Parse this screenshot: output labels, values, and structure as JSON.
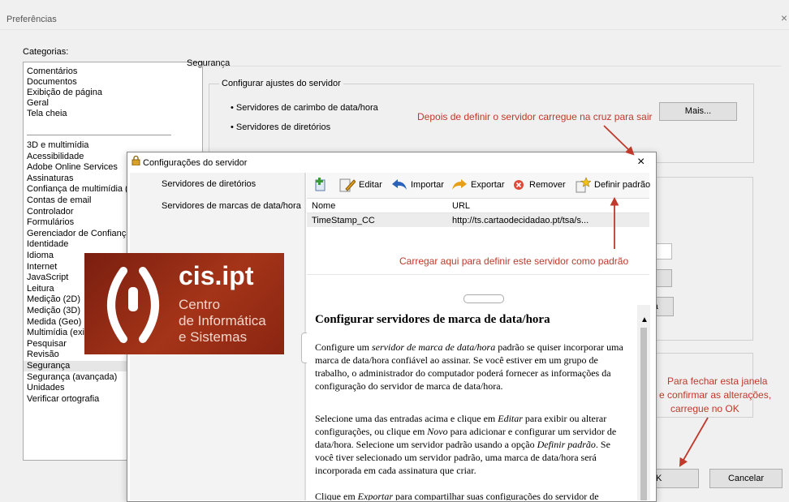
{
  "window": {
    "title": "Preferências",
    "close": "×"
  },
  "categories": {
    "label": "Categorias:",
    "top_items": [
      "Comentários",
      "Documentos",
      "Exibição de página",
      "Geral",
      "Tela cheia"
    ],
    "items": [
      "3D e multimídia",
      "Acessibilidade",
      "Adobe Online Services",
      "Assinaturas",
      "Confiança de multimídia (e",
      "Contas de email",
      "Controlador",
      "Formulários",
      "Gerenciador de Confiança",
      "Identidade",
      "Idioma",
      "Internet",
      "JavaScript",
      "Leitura",
      "Medição (2D)",
      "Medição (3D)",
      "Medida (Geo)",
      "Multimídia (existente)",
      "Pesquisar",
      "Revisão",
      "Segurança",
      "Segurança (avançada)",
      "Unidades",
      "Verificar ortografia"
    ],
    "selected": "Segurança"
  },
  "security": {
    "group": "Segurança",
    "server_group": "Configurar ajustes do servidor",
    "bullet1": "• Servidores de carimbo de data/hora",
    "bullet2": "• Servidores de diretórios",
    "more_button": "Mais...",
    "partial_button": "ra"
  },
  "footer": {
    "ok": "OK",
    "ok_visible": "K",
    "cancel": "Cancelar"
  },
  "annotations": {
    "exit": "Depois de definir o servidor carregue na cruz para sair",
    "default": "Carregar aqui para definir este servidor como padrão",
    "close_line1": "Para fechar esta janela",
    "close_line2": "e confirmar as alterações,",
    "close_line3": "carregue no OK",
    "color": "#c0392b"
  },
  "dialog": {
    "title": "Configurações do servidor",
    "close": "×",
    "nav": [
      "Servidores de diretórios",
      "Servidores de marcas de data/hora"
    ],
    "toolbar": {
      "edit": "Editar",
      "import": "Importar",
      "export": "Exportar",
      "remove": "Remover",
      "default": "Definir padrão"
    },
    "table": {
      "headers": [
        "Nome",
        "URL"
      ],
      "rows": [
        {
          "name": "TimeStamp_CC",
          "url": "http://ts.cartaodecidadao.pt/tsa/s..."
        }
      ]
    },
    "help": {
      "title": "Configurar servidores de marca de data/hora",
      "p1_a": "Configure um ",
      "p1_i": "servidor de marca de data/hora",
      "p1_b": " padrão se quiser incorporar uma marca de data/hora confiável ao assinar. Se você estiver em um grupo de trabalho, o administrador do computador poderá fornecer as informações da configuração do servidor de marca de data/hora.",
      "p2_a": "Selecione uma das entradas acima e clique em ",
      "p2_i1": "Editar",
      "p2_b": " para exibir ou alterar configurações, ou clique em ",
      "p2_i2": "Novo",
      "p2_c": " para adicionar e configurar um servidor de data/hora. Selecione um servidor padrão usando a opção ",
      "p2_i3": "Definir padrão",
      "p2_d": ". Se você tiver selecionado um servidor padrão, uma marca de data/hora será incorporada em cada assinatura que criar.",
      "p3_a": "Clique em ",
      "p3_i": "Exportar",
      "p3_b": " para compartilhar suas configurações do servidor de"
    }
  },
  "logo": {
    "name": "cis.ipt",
    "line1": "Centro",
    "line2": "de Informática",
    "line3": "e Sistemas",
    "bg": "#a43418"
  }
}
